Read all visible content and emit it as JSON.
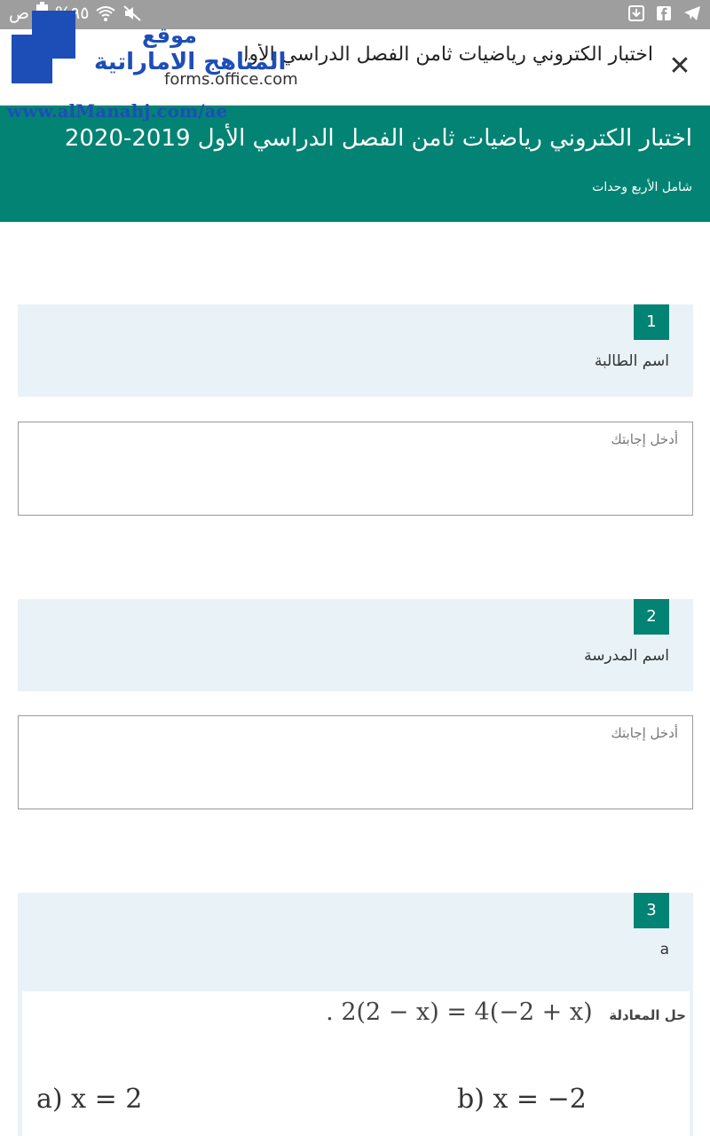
{
  "status_bar": {
    "time": "ص",
    "battery_percent": "%٩٥"
  },
  "app_bar": {
    "title": "اختبار الكتروني رياضيات ثامن الفصل الدراسي الأول 2020-2019",
    "url": "forms.office.com"
  },
  "watermark": {
    "site": "موقع",
    "name": "المناهج الاماراتية",
    "url": "www.alManahj.com/ae"
  },
  "form": {
    "title": "اختبار الكتروني رياضيات ثامن الفصل الدراسي الأول 2019-2020",
    "subtitle": "شامل الأربع وحدات"
  },
  "questions": [
    {
      "number": "1",
      "label": "اسم الطالبة",
      "placeholder": "أدخل إجابتك"
    },
    {
      "number": "2",
      "label": "اسم المدرسة",
      "placeholder": "أدخل إجابتك"
    },
    {
      "number": "3",
      "label": "a"
    }
  ],
  "equation": {
    "prefix": "حل المعادلة",
    "expression": ". 2(2 − x) = 4(−2 + x)",
    "option_a": "a) x = 2",
    "option_b": "b) x = −2"
  }
}
